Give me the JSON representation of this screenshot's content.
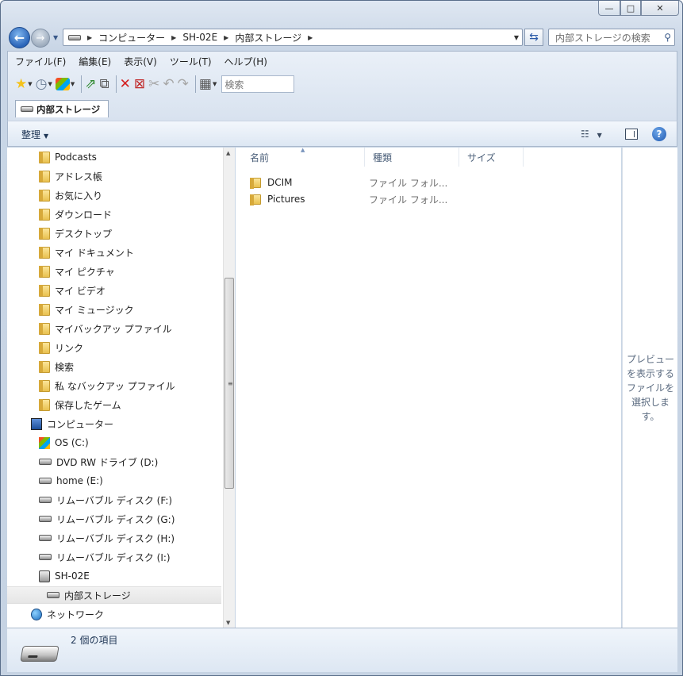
{
  "window": {
    "caption": {
      "min": "—",
      "max": "□",
      "close": "✕"
    }
  },
  "nav": {
    "back_icon": "arrow-left-icon",
    "forward_icon": "arrow-right-icon",
    "address": {
      "segments": [
        "コンピューター",
        "SH-02E",
        "内部ストレージ"
      ]
    },
    "search_placeholder": "内部ストレージの検索"
  },
  "menu": [
    "ファイル(F)",
    "編集(E)",
    "表示(V)",
    "ツール(T)",
    "ヘルプ(H)"
  ],
  "toolbar": {
    "search_placeholder": "検索"
  },
  "tab": {
    "label": "内部ストレージ"
  },
  "organize": {
    "label": "整理"
  },
  "navpane": {
    "items": [
      {
        "label": "Podcasts",
        "icon": "folder-icon"
      },
      {
        "label": "アドレス帳",
        "icon": "contacts-folder-icon"
      },
      {
        "label": "お気に入り",
        "icon": "favorites-folder-icon"
      },
      {
        "label": "ダウンロード",
        "icon": "downloads-folder-icon"
      },
      {
        "label": "デスクトップ",
        "icon": "desktop-folder-icon"
      },
      {
        "label": "マイ ドキュメント",
        "icon": "documents-folder-icon"
      },
      {
        "label": "マイ ピクチャ",
        "icon": "pictures-folder-icon"
      },
      {
        "label": "マイ ビデオ",
        "icon": "videos-folder-icon"
      },
      {
        "label": "マイ ミュージック",
        "icon": "music-folder-icon"
      },
      {
        "label": "マイバックアッ プファイル",
        "icon": "folder-icon"
      },
      {
        "label": "リンク",
        "icon": "links-folder-icon"
      },
      {
        "label": "検索",
        "icon": "search-folder-icon"
      },
      {
        "label": "私 なバックアッ プファイル",
        "icon": "folder-icon"
      },
      {
        "label": "保存したゲーム",
        "icon": "saved-games-folder-icon"
      },
      {
        "label": "コンピューター",
        "icon": "computer-icon"
      },
      {
        "label": "OS (C:)",
        "icon": "windows-drive-icon"
      },
      {
        "label": "DVD RW ドライブ (D:)",
        "icon": "dvd-drive-icon"
      },
      {
        "label": "home (E:)",
        "icon": "drive-icon"
      },
      {
        "label": "リムーバブル ディスク (F:)",
        "icon": "removable-drive-icon"
      },
      {
        "label": "リムーバブル ディスク (G:)",
        "icon": "removable-drive-icon"
      },
      {
        "label": "リムーバブル ディスク (H:)",
        "icon": "removable-drive-icon"
      },
      {
        "label": "リムーバブル ディスク (I:)",
        "icon": "removable-drive-icon"
      },
      {
        "label": "SH-02E",
        "icon": "camera-device-icon"
      },
      {
        "label": "内部ストレージ",
        "icon": "drive-icon"
      },
      {
        "label": "ネットワーク",
        "icon": "network-icon"
      }
    ]
  },
  "columns": [
    "名前",
    "種類",
    "サイズ"
  ],
  "files": [
    {
      "name": "DCIM",
      "type": "ファイル フォル..."
    },
    {
      "name": "Pictures",
      "type": "ファイル フォル..."
    }
  ],
  "preview": {
    "text": "プレビューを表示するファイルを選択します。"
  },
  "details": {
    "count": "2 個の項目"
  },
  "colors": {
    "accent": "#2a64b8",
    "chrome": "#c9d6e6",
    "selection": "#e6e6e6"
  }
}
